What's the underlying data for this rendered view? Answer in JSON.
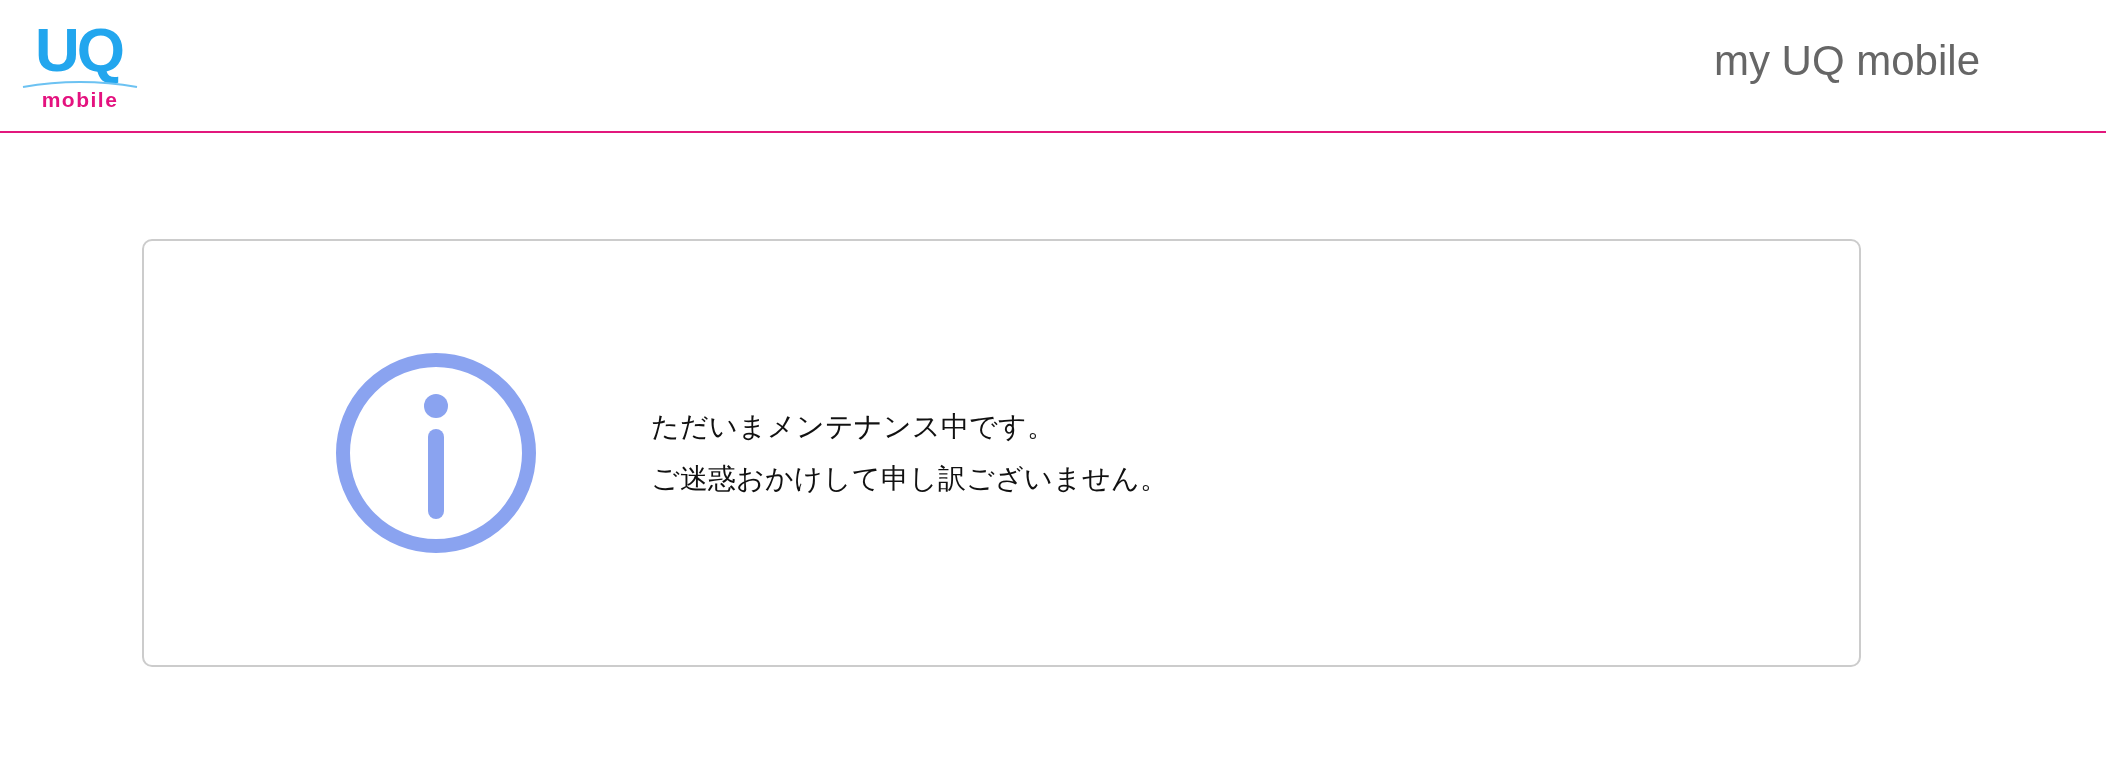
{
  "header": {
    "logo": {
      "mark": "UQ",
      "wordmark": "mobile"
    },
    "title": "my UQ mobile"
  },
  "notice": {
    "kind": "info",
    "lines": [
      "ただいまメンテナンス中です。",
      "ご迷惑おかけして申し訳ございません。"
    ]
  }
}
